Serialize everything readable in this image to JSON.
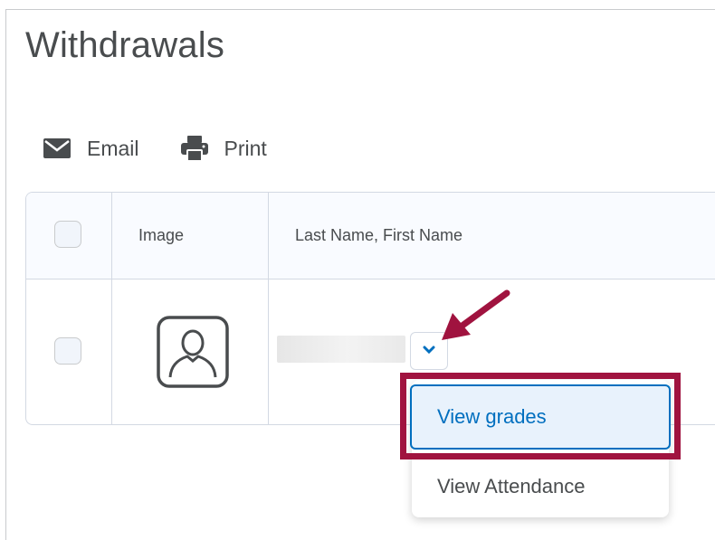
{
  "page": {
    "title": "Withdrawals"
  },
  "toolbar": {
    "email_label": "Email",
    "print_label": "Print"
  },
  "table": {
    "headers": {
      "image": "Image",
      "name": "Last Name, First Name"
    },
    "rows": [
      {
        "name": ""
      }
    ]
  },
  "context_menu": {
    "items": [
      {
        "label": "View grades",
        "selected": true
      },
      {
        "label": "View Attendance",
        "selected": false
      }
    ]
  },
  "colors": {
    "accent": "#006fbf",
    "highlight": "#a0133f",
    "text": "#494c4e"
  },
  "icons": [
    "email-icon",
    "print-icon",
    "user-avatar-icon",
    "chevron-down-icon",
    "annotation-arrow"
  ]
}
